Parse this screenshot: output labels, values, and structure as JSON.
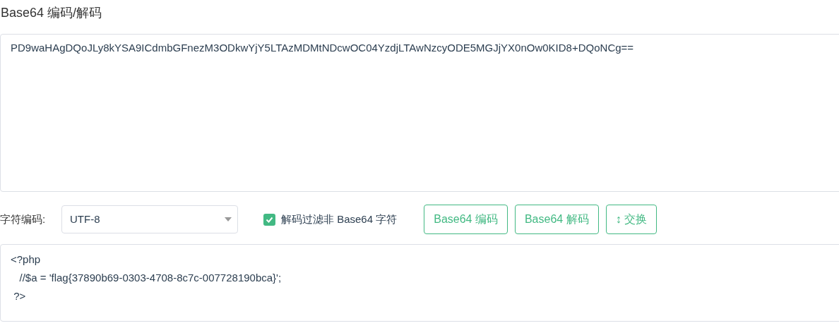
{
  "title": "Base64 编码/解码",
  "input": {
    "value": "PD9waHAgDQoJLy8kYSA9ICdmbGFnezM3ODkwYjY5LTAzMDMtNDcwOC04YzdjLTAwNzcyODE5MGJjYX0nOw0KID8+DQoNCg=="
  },
  "charset": {
    "label": "字符编码:",
    "value": "UTF-8"
  },
  "filter": {
    "label": "解码过滤非 Base64 字符",
    "checked": true
  },
  "buttons": [
    {
      "label": "Base64 编码",
      "kind": "text"
    },
    {
      "label": "Base64 解码",
      "kind": "text"
    },
    {
      "label": "交换",
      "kind": "swap",
      "icon": "↕"
    }
  ],
  "output": {
    "lines": [
      "<?php",
      "\t//$a = 'flag{37890b69-0303-4708-8c7c-007728190bca}';",
      " ?>"
    ]
  }
}
